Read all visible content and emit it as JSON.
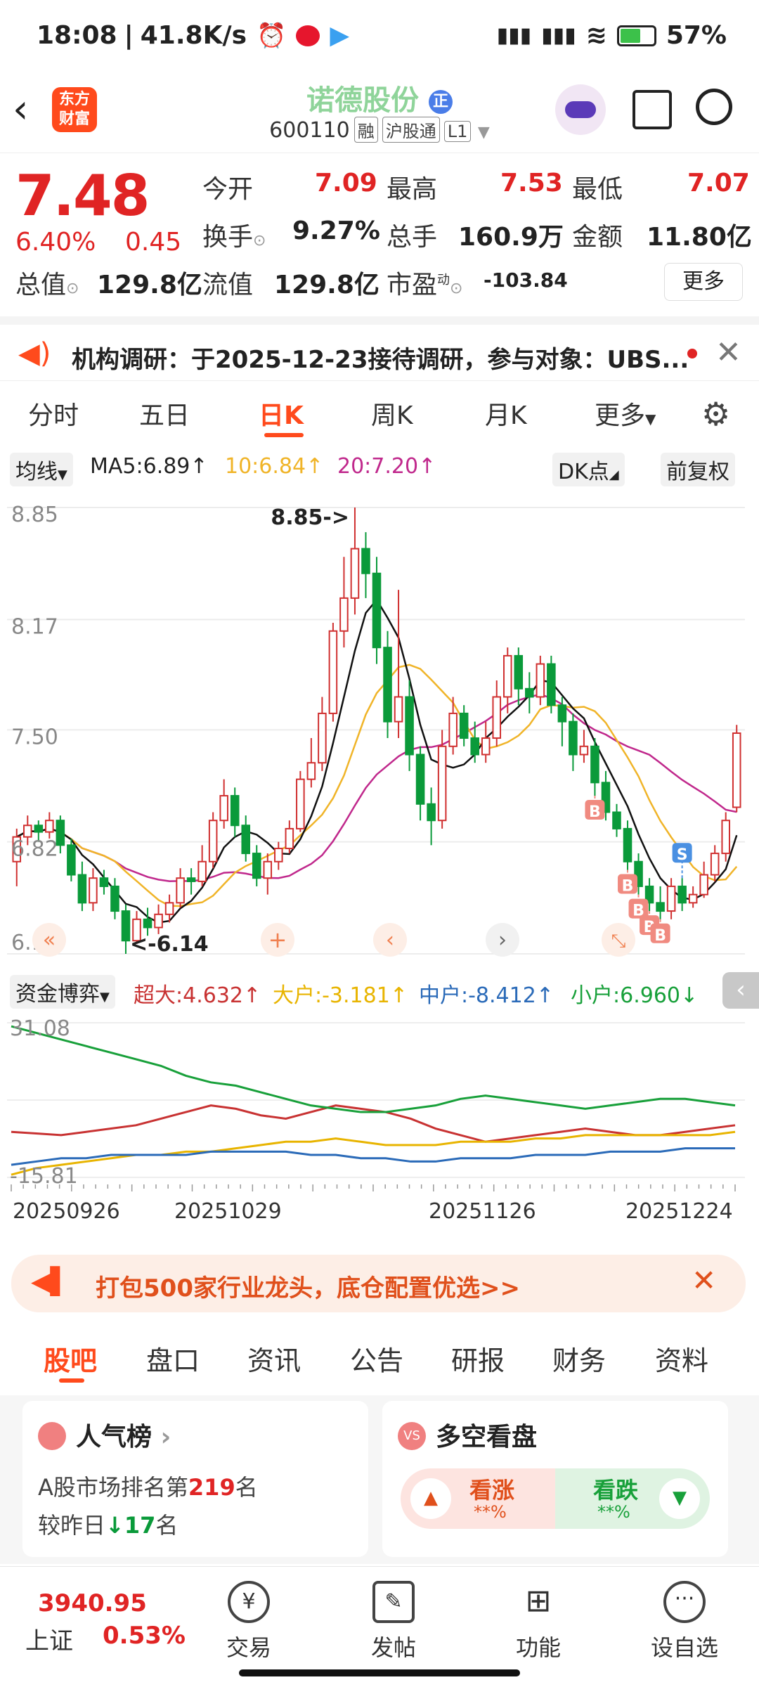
{
  "status_bar": {
    "time": "18:08",
    "speed": "41.8K/s",
    "battery": "57%"
  },
  "header": {
    "logo_line1": "东方",
    "logo_line2": "财富",
    "name": "诺德股份",
    "code": "600110",
    "tags": [
      "融",
      "沪股通",
      "L1"
    ]
  },
  "quote": {
    "price": "7.48",
    "change_pct": "6.40%",
    "change": "0.45",
    "open_label": "今开",
    "open": "7.09",
    "high_label": "最高",
    "high": "7.53",
    "low_label": "最低",
    "low": "7.07",
    "turnover_label": "换手",
    "turnover": "9.27%",
    "volume_label": "总手",
    "volume": "160.9万",
    "amount_label": "金额",
    "amount": "11.80亿",
    "total_mv_label": "总值",
    "total_mv": "129.8亿",
    "float_mv_label": "流值",
    "float_mv": "129.8亿",
    "pe_label": "市盈",
    "pe_sup": "动",
    "pe": "-103.84",
    "more": "更多"
  },
  "notice": {
    "text": "机构调研：于2025-12-23接待调研，参与对象：UBS..."
  },
  "tabs": [
    "分时",
    "五日",
    "日K",
    "周K",
    "月K",
    "更多"
  ],
  "ma_legend": {
    "selector": "均线",
    "ma5": "MA5:6.89",
    "ma10": "10:6.84",
    "ma20": "20:7.20",
    "dk": "DK点",
    "fq": "前复权"
  },
  "chart_data": [
    {
      "type": "candlestick",
      "y_ticks": [
        "8.85",
        "8.17",
        "7.50",
        "6.82",
        "6.14"
      ],
      "ylim": [
        6.14,
        8.85
      ],
      "annotations": [
        "8.85->",
        "<-6.14"
      ],
      "signals": [
        "B",
        "B",
        "B",
        "B",
        "B",
        "S"
      ],
      "series_colors": {
        "ma5": "#111111",
        "ma10": "#f0b428",
        "ma20": "#c0288c",
        "up": "#d03030",
        "down": "#0a9a3a"
      },
      "candles": [
        [
          6.7,
          6.85,
          6.55,
          6.9
        ],
        [
          6.85,
          6.92,
          6.8,
          6.98
        ],
        [
          6.92,
          6.88,
          6.82,
          6.95
        ],
        [
          6.88,
          6.95,
          6.84,
          7.0
        ],
        [
          6.95,
          6.8,
          6.75,
          6.98
        ],
        [
          6.8,
          6.62,
          6.58,
          6.84
        ],
        [
          6.62,
          6.45,
          6.4,
          6.7
        ],
        [
          6.45,
          6.6,
          6.4,
          6.66
        ],
        [
          6.6,
          6.55,
          6.5,
          6.65
        ],
        [
          6.55,
          6.4,
          6.35,
          6.6
        ],
        [
          6.4,
          6.22,
          6.14,
          6.44
        ],
        [
          6.22,
          6.35,
          6.2,
          6.4
        ],
        [
          6.35,
          6.3,
          6.25,
          6.42
        ],
        [
          6.3,
          6.38,
          6.26,
          6.44
        ],
        [
          6.38,
          6.45,
          6.33,
          6.5
        ],
        [
          6.45,
          6.6,
          6.42,
          6.66
        ],
        [
          6.6,
          6.58,
          6.5,
          6.66
        ],
        [
          6.58,
          6.7,
          6.55,
          6.8
        ],
        [
          6.7,
          6.95,
          6.66,
          7.0
        ],
        [
          6.95,
          7.1,
          6.9,
          7.2
        ],
        [
          7.1,
          6.92,
          6.85,
          7.15
        ],
        [
          6.92,
          6.75,
          6.7,
          6.98
        ],
        [
          6.75,
          6.6,
          6.55,
          6.8
        ],
        [
          6.6,
          6.7,
          6.5,
          6.75
        ],
        [
          6.7,
          6.78,
          6.65,
          6.82
        ],
        [
          6.78,
          6.9,
          6.75,
          6.95
        ],
        [
          6.9,
          7.2,
          6.88,
          7.25
        ],
        [
          7.2,
          7.3,
          7.15,
          7.45
        ],
        [
          7.3,
          7.6,
          7.25,
          7.7
        ],
        [
          7.6,
          8.1,
          7.55,
          8.15
        ],
        [
          8.1,
          8.3,
          8.0,
          8.55
        ],
        [
          8.3,
          8.6,
          8.2,
          8.85
        ],
        [
          8.6,
          8.45,
          8.3,
          8.7
        ],
        [
          8.45,
          8.0,
          7.9,
          8.55
        ],
        [
          8.0,
          7.55,
          7.45,
          8.1
        ],
        [
          7.55,
          7.7,
          7.45,
          8.35
        ],
        [
          7.7,
          7.35,
          7.25,
          7.8
        ],
        [
          7.35,
          7.05,
          6.95,
          7.4
        ],
        [
          7.05,
          6.95,
          6.8,
          7.15
        ],
        [
          6.95,
          7.4,
          6.9,
          7.5
        ],
        [
          7.4,
          7.6,
          7.35,
          7.7
        ],
        [
          7.6,
          7.45,
          7.4,
          7.65
        ],
        [
          7.45,
          7.35,
          7.3,
          7.55
        ],
        [
          7.35,
          7.45,
          7.3,
          7.55
        ],
        [
          7.45,
          7.7,
          7.4,
          7.8
        ],
        [
          7.7,
          7.95,
          7.6,
          8.0
        ],
        [
          7.95,
          7.75,
          7.65,
          8.0
        ],
        [
          7.75,
          7.7,
          7.6,
          7.85
        ],
        [
          7.7,
          7.9,
          7.65,
          7.95
        ],
        [
          7.9,
          7.65,
          7.6,
          7.95
        ],
        [
          7.65,
          7.55,
          7.4,
          7.7
        ],
        [
          7.55,
          7.35,
          7.25,
          7.6
        ],
        [
          7.35,
          7.4,
          7.3,
          7.5
        ],
        [
          7.4,
          7.18,
          7.1,
          7.45
        ],
        [
          7.18,
          7.0,
          6.95,
          7.25
        ],
        [
          7.0,
          6.9,
          6.85,
          7.05
        ],
        [
          6.9,
          6.7,
          6.65,
          6.95
        ],
        [
          6.7,
          6.55,
          6.5,
          6.75
        ],
        [
          6.55,
          6.45,
          6.4,
          6.6
        ],
        [
          6.45,
          6.4,
          6.35,
          6.55
        ],
        [
          6.4,
          6.55,
          6.35,
          6.6
        ],
        [
          6.55,
          6.45,
          6.4,
          6.6
        ],
        [
          6.45,
          6.5,
          6.42,
          6.55
        ],
        [
          6.5,
          6.62,
          6.48,
          6.7
        ],
        [
          6.62,
          6.75,
          6.58,
          6.8
        ],
        [
          6.75,
          6.95,
          6.7,
          7.0
        ],
        [
          7.03,
          7.48,
          7.0,
          7.53
        ]
      ]
    },
    {
      "type": "line",
      "indicator": "资金博弈",
      "ylim": [
        -15.81,
        31.08
      ],
      "y_ticks": [
        "31.08",
        "-15.81"
      ],
      "x_ticks": [
        "20250926",
        "20251029",
        "20251126",
        "20251224"
      ],
      "series": [
        {
          "name": "超大:4.632",
          "color": "#c83232",
          "values": [
            -2,
            -2.5,
            -3,
            -2,
            -1,
            0,
            2,
            4,
            6,
            5,
            3,
            2,
            4,
            6,
            5,
            4,
            2,
            -1,
            -3,
            -5,
            -4,
            -3,
            -2,
            -1,
            -2,
            -3,
            -3,
            -2,
            -1,
            0
          ]
        },
        {
          "name": "大户:-3.181",
          "color": "#e8b400",
          "values": [
            -15,
            -13,
            -12,
            -11,
            -10,
            -9,
            -9,
            -8,
            -8,
            -7,
            -6,
            -5,
            -5,
            -4,
            -5,
            -6,
            -6,
            -6,
            -5,
            -5,
            -5,
            -4,
            -4,
            -3,
            -3,
            -3,
            -3,
            -3,
            -3,
            -2
          ]
        },
        {
          "name": "中户:-8.412",
          "color": "#2a6ab8",
          "values": [
            -12,
            -11,
            -10,
            -10,
            -9,
            -9,
            -9,
            -9,
            -8,
            -8,
            -8,
            -8,
            -9,
            -9,
            -10,
            -10,
            -11,
            -11,
            -10,
            -10,
            -10,
            -9,
            -9,
            -9,
            -8,
            -8,
            -8,
            -7,
            -7,
            -7
          ]
        },
        {
          "name": "小户:6.960",
          "color": "#18a03a",
          "values": [
            30,
            28,
            26,
            24,
            22,
            20,
            18,
            15,
            13,
            12,
            10,
            8,
            6,
            5,
            4,
            4,
            5,
            6,
            8,
            9,
            8,
            7,
            6,
            5,
            6,
            7,
            8,
            8,
            7,
            6
          ]
        }
      ]
    }
  ],
  "flow_legend": {
    "selector": "资金博弈",
    "super": "超大:4.632",
    "large": "大户:-3.181",
    "mid": "中户:-8.412",
    "small": "小户:6.960"
  },
  "promo": {
    "text": "打包500家行业龙头，底仓配置优选>>"
  },
  "subtabs": [
    "股吧",
    "盘口",
    "资讯",
    "公告",
    "研报",
    "财务",
    "资料"
  ],
  "cards": {
    "popularity": {
      "title": "人气榜",
      "rank_prefix": "A股市场排名第",
      "rank": "219",
      "rank_suffix": "名",
      "change_prefix": "较昨日",
      "change": "17",
      "change_suffix": "名"
    },
    "sentiment": {
      "title": "多空看盘",
      "bull": "看涨",
      "bull_pct": "**%",
      "bear": "看跌",
      "bear_pct": "**%"
    }
  },
  "bottom_bar": {
    "index_value": "3940.95",
    "index_name": "上证",
    "index_change": "0.53%",
    "items": [
      "交易",
      "发帖",
      "功能",
      "设自选"
    ]
  }
}
